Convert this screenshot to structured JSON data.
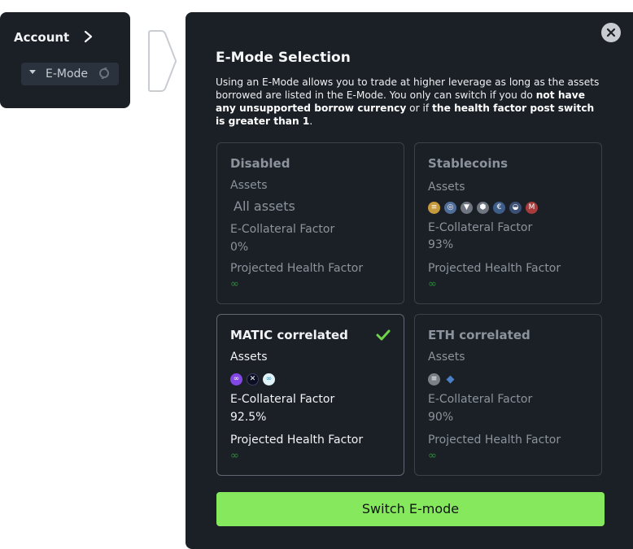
{
  "account": {
    "title": "Account",
    "emode_label": "E-Mode"
  },
  "modal": {
    "title": "E-Mode Selection",
    "description": {
      "part1": "Using an E-Mode allows you to trade at higher leverage as long as the assets borrowed are listed in the E-Mode. You only can switch if you do ",
      "bold1": "not have any unsupported borrow currency",
      "part2": " or if ",
      "bold2": "the health factor post switch is greater than 1",
      "part3": "."
    },
    "cards": [
      {
        "title": "Disabled",
        "assets_label": "Assets",
        "assets_text": "All assets",
        "collateral_label": "E-Collateral Factor",
        "collateral_value": "0%",
        "health_label": "Projected Health Factor",
        "health_value": "∞",
        "selected": false
      },
      {
        "title": "Stablecoins",
        "assets_label": "Assets",
        "asset_icons": [
          "dai-icon",
          "usdc-icon",
          "usdt-icon",
          "miMATIC-icon",
          "eurs-icon",
          "agEUR-icon",
          "jEUR-icon"
        ],
        "collateral_label": "E-Collateral Factor",
        "collateral_value": "93%",
        "health_label": "Projected Health Factor",
        "health_value": "∞",
        "selected": false
      },
      {
        "title": "MATIC correlated",
        "assets_label": "Assets",
        "asset_icons": [
          "matic-icon",
          "stmatic-icon",
          "maticx-icon"
        ],
        "collateral_label": "E-Collateral Factor",
        "collateral_value": "92.5%",
        "health_label": "Projected Health Factor",
        "health_value": "∞",
        "selected": true
      },
      {
        "title": "ETH correlated",
        "assets_label": "Assets",
        "asset_icons": [
          "wsteth-icon",
          "weth-icon"
        ],
        "collateral_label": "E-Collateral Factor",
        "collateral_value": "90%",
        "health_label": "Projected Health Factor",
        "health_value": "∞",
        "selected": false
      }
    ],
    "switch_button": "Switch E-mode"
  },
  "colors": {
    "panel_bg": "#1b2027",
    "accent_green": "#86e85d",
    "check_green": "#6fd34a",
    "infinity_green": "#2f8b3a",
    "muted_text": "#8c939c"
  }
}
